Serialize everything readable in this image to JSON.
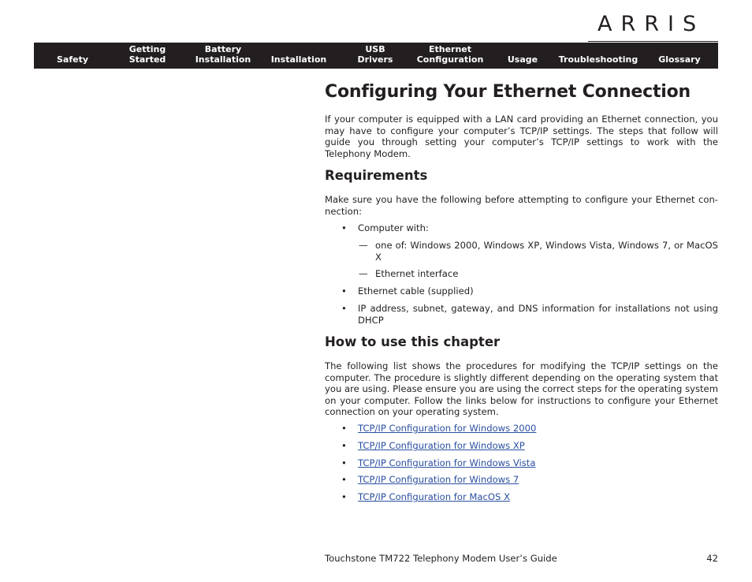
{
  "brand": {
    "logo_text": "ARRIS"
  },
  "nav": {
    "items": [
      {
        "label_line1": "",
        "label_line2": "Safety"
      },
      {
        "label_line1": "Getting",
        "label_line2": "Started"
      },
      {
        "label_line1": "Battery",
        "label_line2": "Installation"
      },
      {
        "label_line1": "",
        "label_line2": "Installation"
      },
      {
        "label_line1": "USB",
        "label_line2": "Drivers"
      },
      {
        "label_line1": "Ethernet",
        "label_line2": "Configuration"
      },
      {
        "label_line1": "",
        "label_line2": "Usage"
      },
      {
        "label_line1": "",
        "label_line2": "Troubleshooting"
      },
      {
        "label_line1": "",
        "label_line2": "Glossary"
      }
    ]
  },
  "page": {
    "title": "Configuring Your Ethernet Connection",
    "intro": "If your computer is equipped with a LAN card providing an Ethernet connection, you may have to configure your computer’s TCP/IP settings. The steps that follow will guide you through setting your computer’s TCP/IP settings to work with the Telephony Modem.",
    "requirements": {
      "heading": "Requirements",
      "lead": "Make sure you have the following before attempting to configure your Ethernet con-nection:",
      "items": [
        {
          "text": "Computer with:",
          "sub": [
            "one of: Windows 2000, Windows XP, Windows Vista, Windows 7, or MacOS X",
            "Ethernet interface"
          ]
        },
        {
          "text": "Ethernet cable (supplied)"
        },
        {
          "text": "IP address, subnet, gateway, and DNS information for installations not using DHCP"
        }
      ],
      "bullet_glyph": "•",
      "dash_glyph": "—"
    },
    "how_to": {
      "heading": "How to use this chapter",
      "body": "The following list shows the procedures for modifying the TCP/IP settings on the computer. The procedure is slightly different depending on the operating system that you are using. Please ensure you are using the correct steps for the operating system on your computer. Follow the links below for instructions to configure your Ethernet connection on your operating system.",
      "links": [
        "TCP/IP Configuration for Windows 2000",
        "TCP/IP Configuration for Windows XP",
        "TCP/IP Configuration for Windows Vista",
        "TCP/IP Configuration for Windows 7",
        "TCP/IP Configuration for MacOS X"
      ]
    }
  },
  "footer": {
    "guide_title": "Touchstone TM722 Telephony Modem User’s Guide",
    "page_number": "42"
  },
  "colors": {
    "nav_background": "#231f20",
    "nav_text": "#ffffff",
    "link": "#2a4fa0",
    "body_text": "#231f20"
  }
}
